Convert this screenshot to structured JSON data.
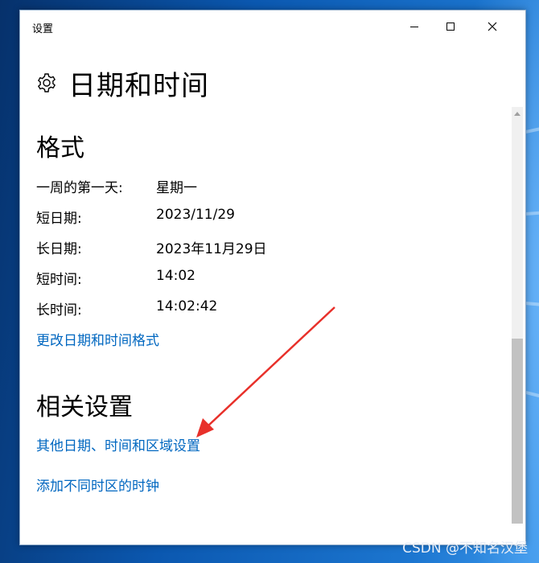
{
  "window": {
    "title": "设置",
    "page_title": "日期和时间",
    "icons": {
      "settings": "gear-icon",
      "minimize": "minimize-icon",
      "maximize": "maximize-icon",
      "close": "close-icon"
    }
  },
  "format_section": {
    "heading": "格式",
    "rows": [
      {
        "label": "一周的第一天:",
        "value": "星期一"
      },
      {
        "label": "短日期:",
        "value": "2023/11/29"
      },
      {
        "label": "长日期:",
        "value": "2023年11月29日"
      },
      {
        "label": "短时间:",
        "value": "14:02"
      },
      {
        "label": "长时间:",
        "value": "14:02:42"
      }
    ],
    "change_link": "更改日期和时间格式"
  },
  "related_section": {
    "heading": "相关设置",
    "links": [
      "其他日期、时间和区域设置",
      "添加不同时区的时钟"
    ]
  },
  "annotation": {
    "color": "#e8302a",
    "type": "arrow"
  },
  "watermark": "CSDN @不知名汉堡",
  "colors": {
    "link": "#0067c0",
    "background": "#ffffff",
    "desktop": "#0b58b0"
  }
}
